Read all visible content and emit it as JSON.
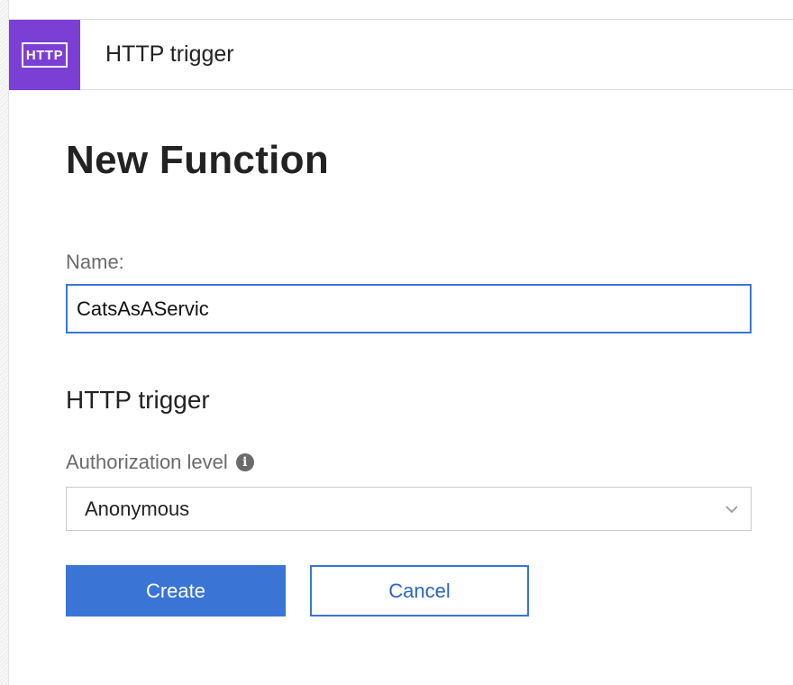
{
  "header": {
    "badge_text": "HTTP",
    "badge_color": "#7b3fd6",
    "title": "HTTP trigger"
  },
  "form": {
    "title": "New Function",
    "name_label": "Name:",
    "name_value": "CatsAsAServic",
    "section_title": "HTTP trigger",
    "auth_label": "Authorization level",
    "auth_info_icon": "info-icon",
    "auth_value": "Anonymous",
    "create_label": "Create",
    "cancel_label": "Cancel",
    "accent_color": "#3a75d6"
  }
}
